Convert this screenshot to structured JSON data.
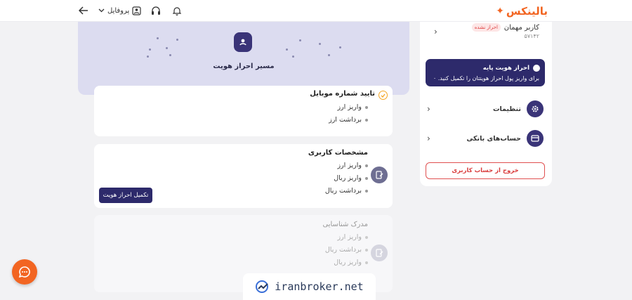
{
  "header": {
    "logo_text": "بالینکس",
    "profile_label": "پروفایل"
  },
  "hero": {
    "title": "مسیر احراز هویت"
  },
  "cards": [
    {
      "title": "تایید شماره موبایل",
      "items": [
        "واریز ارز",
        "برداشت ارز"
      ]
    },
    {
      "title": "مشخصات کاربری",
      "items": [
        "واریز ارز",
        "واریز ریال",
        "برداشت ریال"
      ],
      "button_label": "تکمیل احراز هویت"
    },
    {
      "title": "مدرک شناسایی",
      "items": [
        "واریز ارز",
        "برداشت ریال",
        "واریز ریال"
      ]
    }
  ],
  "sidebar": {
    "user_name": "کاربر مهمان",
    "status_badge": "احراز نشده",
    "user_id": "۵۷۱۴۲",
    "kyc": {
      "title": "احراز هویت پایه",
      "description": "برای واریز پول احراز هویتتان را تکمیل کنید. ۰"
    },
    "menu": [
      {
        "label": "تنظیمات",
        "icon": "gear-icon"
      },
      {
        "label": "حساب‌های بانکی",
        "icon": "bank-card-icon"
      }
    ],
    "logout_label": "خروج از حساب کاربری"
  },
  "watermark": {
    "text": "iranbroker.net"
  },
  "colors": {
    "brand": "#f26522",
    "primary": "#2d2a6b",
    "danger": "#e05050"
  }
}
